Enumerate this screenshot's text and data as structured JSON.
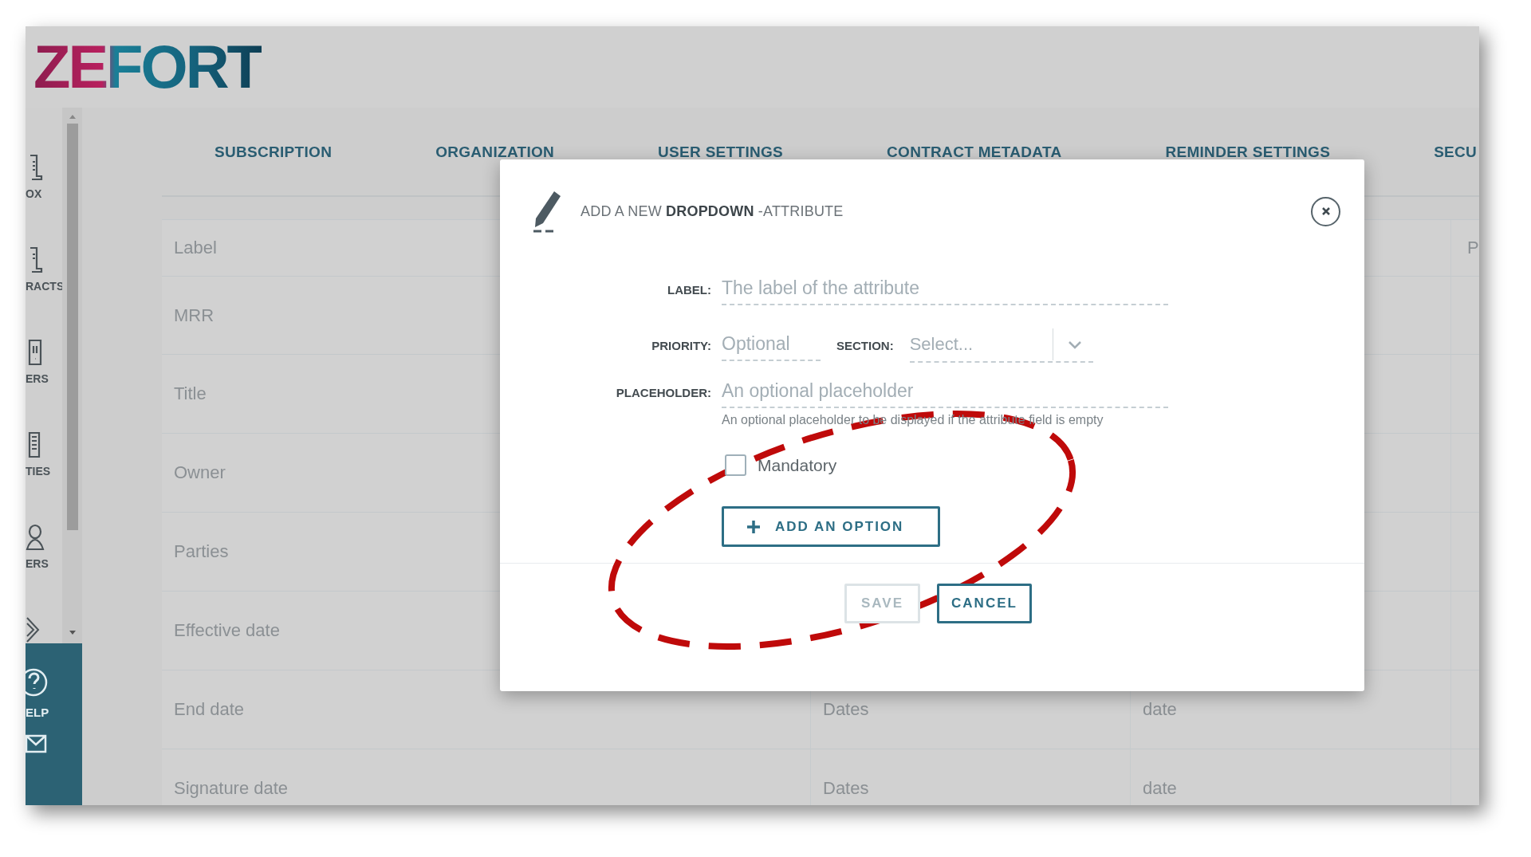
{
  "logo": {
    "text": "ZEFORT"
  },
  "sidebar": {
    "items": [
      {
        "label": "OX"
      },
      {
        "label": "RACTS"
      },
      {
        "label": "ERS"
      },
      {
        "label": "TIES"
      },
      {
        "label": "ERS"
      }
    ],
    "help": {
      "label": "ELP"
    }
  },
  "tabs": [
    {
      "label": "SUBSCRIPTION"
    },
    {
      "label": "ORGANIZATION"
    },
    {
      "label": "USER SETTINGS"
    },
    {
      "label": "CONTRACT METADATA"
    },
    {
      "label": "REMINDER SETTINGS"
    },
    {
      "label": "SECU"
    }
  ],
  "table": {
    "header": {
      "column_1": "Label",
      "column_4": "P"
    },
    "rows": [
      {
        "column_1": "MRR"
      },
      {
        "column_1": "Title"
      },
      {
        "column_1": "Owner"
      },
      {
        "column_1": "Parties"
      },
      {
        "column_1": "Effective date"
      },
      {
        "column_1": "End date",
        "column_2": "Dates",
        "column_3": "date"
      },
      {
        "column_1": "Signature date",
        "column_2": "Dates",
        "column_3": "date"
      }
    ]
  },
  "dialog": {
    "title": "ADD A NEW **DROPDOWN** -ATTRIBUTE",
    "label_field": {
      "label": "LABEL:",
      "placeholder": "The label of the attribute"
    },
    "priority_field": {
      "label": "PRIORITY:",
      "placeholder": "Optional"
    },
    "section_field": {
      "label": "SECTION:",
      "placeholder": "Select..."
    },
    "placeholder_field": {
      "label": "PLACEHOLDER:",
      "placeholder": "An optional placeholder",
      "hint": "An optional placeholder to be displayed if the attribute field is empty"
    },
    "mandatory": {
      "label": "Mandatory",
      "checked": false
    },
    "add_option_button": {
      "label": "ADD AN OPTION"
    },
    "buttons": [
      {
        "label": "SAVE",
        "disabled": true
      },
      {
        "label": "CANCEL",
        "disabled": false
      }
    ]
  }
}
